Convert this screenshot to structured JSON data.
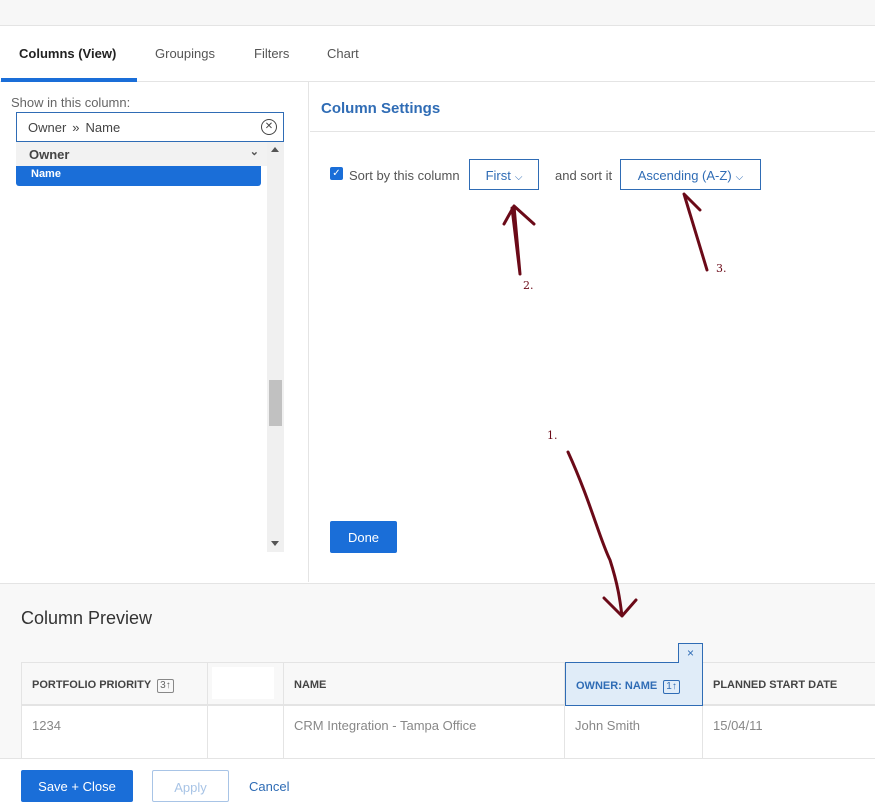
{
  "tabs": [
    {
      "label": "Columns (View)",
      "active": true
    },
    {
      "label": "Groupings",
      "active": false
    },
    {
      "label": "Filters",
      "active": false
    },
    {
      "label": "Chart",
      "active": false
    }
  ],
  "left_panel": {
    "show_label": "Show in this column:",
    "field_value": {
      "parent": "Owner",
      "separator": "»",
      "child": "Name"
    },
    "group_label": "Owner",
    "selected_item": "Name"
  },
  "column_settings": {
    "title": "Column Settings",
    "sort_checkbox_label": "Sort by this column",
    "sort_checked": true,
    "sort_order_value": "First",
    "and_sort_label": "and sort it",
    "sort_direction_value": "Ascending (A-Z)",
    "done_label": "Done"
  },
  "preview": {
    "title": "Column Preview",
    "columns": [
      {
        "header": "PORTFOLIO PRIORITY",
        "sort_badge": "3↑",
        "value": "1234"
      },
      {
        "header": "",
        "sort_badge": "",
        "value": ""
      },
      {
        "header": "NAME",
        "sort_badge": "",
        "value": "CRM Integration - Tampa Office"
      },
      {
        "header": "OWNER: NAME",
        "sort_badge": "1↑",
        "value": "John Smith",
        "selected": true
      },
      {
        "header": "PLANNED START DATE",
        "sort_badge": "",
        "value": "15/04/11"
      }
    ],
    "remove_column_icon": "×"
  },
  "footer": {
    "save_label": "Save + Close",
    "apply_label": "Apply",
    "cancel_label": "Cancel"
  },
  "annotations": {
    "color": "#6b0a18",
    "labels": [
      "1.",
      "2.",
      "3."
    ]
  }
}
